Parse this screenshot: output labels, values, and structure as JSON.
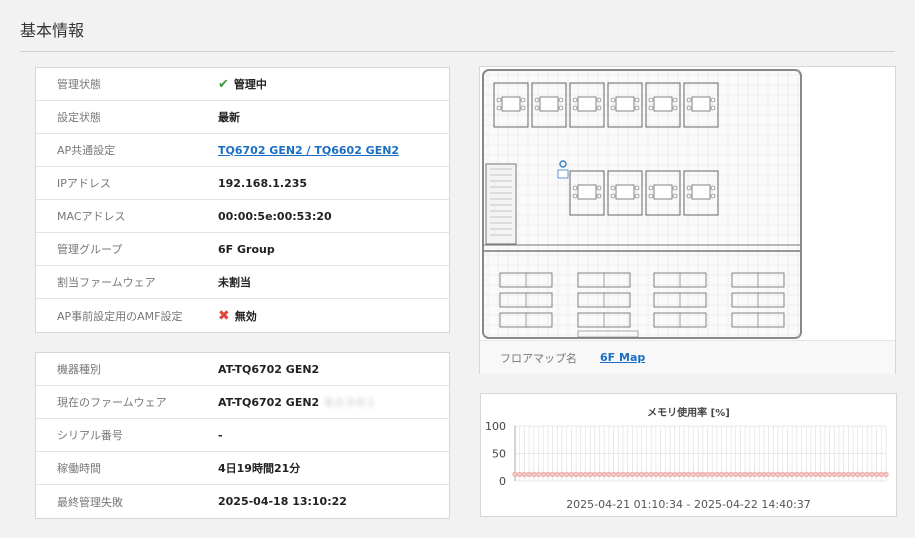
{
  "page_title": "基本情報",
  "status_table": [
    {
      "label": "管理状態",
      "value": "管理中",
      "icon": "check-icon"
    },
    {
      "label": "設定状態",
      "value": "最新"
    },
    {
      "label": "AP共通設定",
      "value": "TQ6702 GEN2 / TQ6602 GEN2",
      "link": true
    },
    {
      "label": "IPアドレス",
      "value": "192.168.1.235"
    },
    {
      "label": "MACアドレス",
      "value": "00:00:5e:00:53:20"
    },
    {
      "label": "管理グループ",
      "value": "6F Group"
    },
    {
      "label": "割当ファームウェア",
      "value": "未割当"
    },
    {
      "label": "AP事前設定用のAMF設定",
      "value": "無効",
      "icon": "cross-icon"
    }
  ],
  "device_table": [
    {
      "label": "機器種別",
      "value": "AT-TQ6702 GEN2"
    },
    {
      "label": "現在のファームウェア",
      "value": "AT-TQ6702 GEN2",
      "blurred": "8.0.3-0.1"
    },
    {
      "label": "シリアル番号",
      "value": "-"
    },
    {
      "label": "稼働時間",
      "value": "4日19時間21分"
    },
    {
      "label": "最終管理失敗",
      "value": "2025-04-18 13:10:22"
    }
  ],
  "floor_map": {
    "label": "フロアマップ名",
    "name": "6F Map"
  },
  "colors": {
    "link": "#1a6fc4",
    "check": "#3a9a3a",
    "cross": "#e0463a",
    "series": "#e89a9a"
  },
  "chart_data": {
    "type": "line",
    "title": "メモリ使用率 [%]",
    "ylim": [
      0,
      100
    ],
    "yticks": [
      0,
      50,
      100
    ],
    "grid": true,
    "series": [
      {
        "values": [
          12,
          12,
          12,
          12,
          12,
          12,
          12,
          12,
          12,
          12,
          12,
          12,
          12,
          12,
          12,
          12,
          12,
          12,
          12,
          12,
          12,
          12,
          12,
          12,
          12,
          12,
          12,
          12,
          12,
          12,
          12,
          12,
          12,
          12,
          12,
          12,
          12,
          12,
          12,
          12,
          12,
          12,
          12,
          12,
          12,
          12,
          12,
          12,
          12,
          12,
          12,
          12,
          12,
          12,
          12,
          12,
          12,
          12,
          12,
          12,
          12,
          12,
          12,
          12,
          12,
          12,
          12,
          12,
          12,
          12,
          12,
          12,
          12,
          12,
          12,
          12,
          12,
          12,
          12,
          12
        ]
      }
    ],
    "x_range_label": "2025-04-21 01:10:34 - 2025-04-22 14:40:37"
  }
}
